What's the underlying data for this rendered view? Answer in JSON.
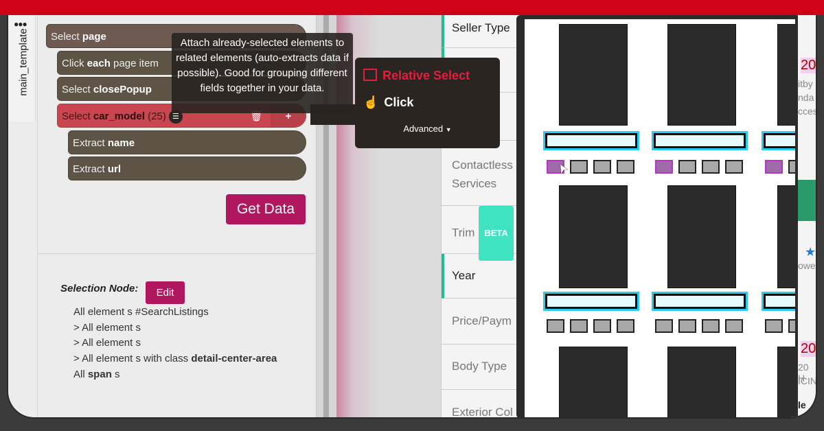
{
  "sidebar_tab": {
    "label": "main_template",
    "menu_icon": "more-dots"
  },
  "tree": [
    {
      "verb": "Select",
      "target": "page",
      "suffix": ""
    },
    {
      "verb": "Click",
      "target": "each",
      "suffix": "page item"
    },
    {
      "verb": "Select",
      "target": "closePopup",
      "suffix": ""
    },
    {
      "verb": "Select",
      "target": "car_model",
      "suffix": "(25)"
    },
    {
      "verb": "Extract",
      "target": "name",
      "suffix": ""
    },
    {
      "verb": "Extract",
      "target": "url",
      "suffix": ""
    }
  ],
  "get_data_label": "Get Data",
  "selection": {
    "title": "Selection Node:",
    "edit_label": "Edit",
    "lines": [
      "All element s #SearchListings",
      "> All element s",
      "> All element s",
      "> All element s with class",
      "detail-center-area",
      "All",
      "span",
      "s"
    ]
  },
  "tooltip": "Attach already-selected elements to related elements (auto-extracts data if possible). Good for grouping different fields together in your data.",
  "menu": {
    "relative_select": "Relative Select",
    "click": "Click",
    "advanced": "Advanced",
    "accent": "#e0203a"
  },
  "filters": [
    {
      "label": "Seller Type",
      "active": true
    },
    {
      "label": "",
      "active": true
    },
    {
      "label": "",
      "active": false
    },
    {
      "label": "Contactless Services",
      "active": false
    },
    {
      "label": "Trim",
      "badge": "BETA",
      "active": false
    },
    {
      "label": "Year",
      "active": true
    },
    {
      "label": "Price/Paym",
      "active": false
    },
    {
      "label": "Body Type",
      "active": false
    },
    {
      "label": "Exterior Col",
      "active": false
    }
  ],
  "right_fragments": [
    "20",
    "itby",
    "nda",
    "cces",
    "owe",
    "20",
    "20 H",
    "ICIN",
    "le"
  ],
  "colors": {
    "brand_red": "#d0021b",
    "magenta": "#b0175e",
    "teal": "#1fbf8f",
    "cyan": "#2ccbee"
  }
}
